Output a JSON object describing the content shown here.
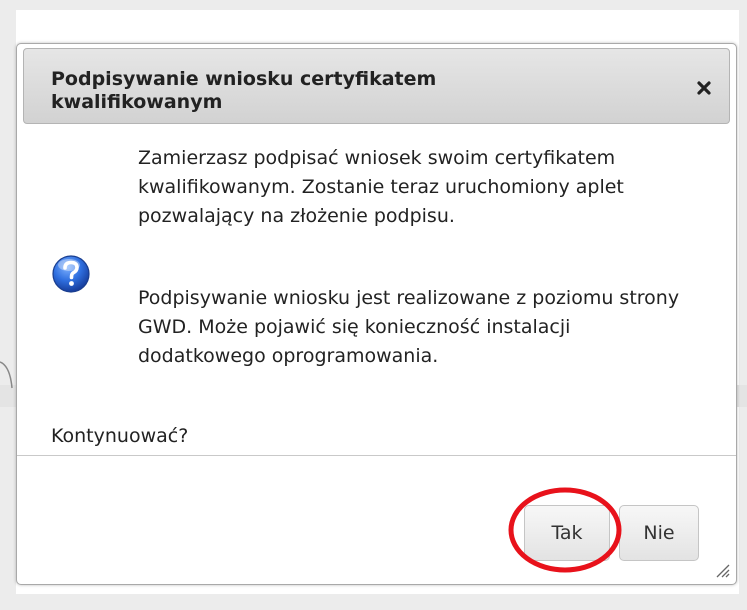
{
  "dialog": {
    "title": "Podpisywanie wniosku certyfikatem kwalifikowanym",
    "close_icon": "close-icon",
    "icon": "question-icon",
    "message_1": "Zamierzasz podpisać wniosek swoim certyfikatem kwalifikowanym. Zostanie teraz uruchomiony aplet pozwalający na złożenie podpisu.",
    "message_2": "Podpisywanie wniosku jest realizowane z poziomu strony GWD. Może pojawić się konieczność instalacji dodatkowego oprogramowania.",
    "question": "Kontynuować?",
    "yes_label": "Tak",
    "no_label": "Nie",
    "highlight_color": "#e8121b"
  }
}
